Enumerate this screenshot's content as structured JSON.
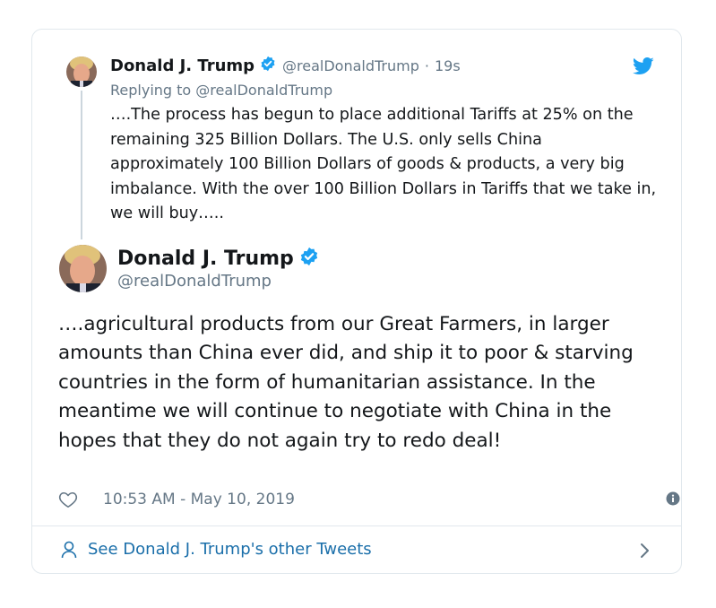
{
  "colors": {
    "verified": "#1da1f2",
    "twitter_blue": "#1da1f2",
    "link": "#1b6faa",
    "secondary_text": "#657786",
    "border": "#e1e8ed"
  },
  "parent_tweet": {
    "author_name": "Donald J. Trump",
    "handle": "@realDonaldTrump",
    "separator": "·",
    "time_ago": "19s",
    "replying_to": "Replying to @realDonaldTrump",
    "text": "….The process has begun to place additional Tariffs at 25% on the remaining 325 Billion Dollars. The U.S. only sells China approximately 100 Billion Dollars of goods & products, a very big imbalance. With the over 100 Billion Dollars in Tariffs that we take in, we will buy….."
  },
  "main_tweet": {
    "author_name": "Donald J. Trump",
    "handle": "@realDonaldTrump",
    "text": "….agricultural products from our Great Farmers, in larger amounts than China ever did, and ship it to poor & starving countries in the form of humanitarian assistance. In the meantime we will continue to negotiate with China in the hopes that they do not again try to redo deal!",
    "timestamp": "10:53 AM - May 10, 2019"
  },
  "footer": {
    "link_label": "See Donald J. Trump's other Tweets"
  },
  "icons": {
    "verified": "verified-badge-icon",
    "bird": "twitter-bird-icon",
    "like": "heart-icon",
    "info": "info-icon",
    "person": "person-icon",
    "chevron": "chevron-right-icon"
  }
}
